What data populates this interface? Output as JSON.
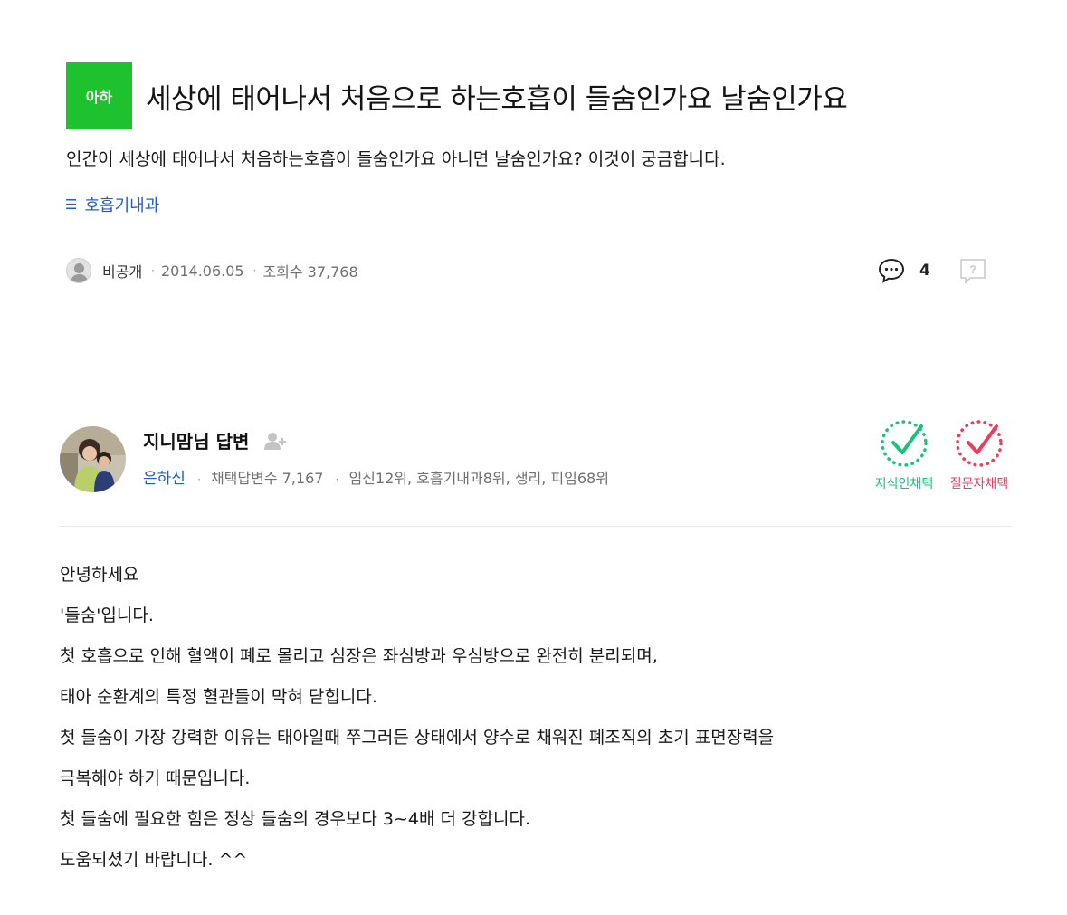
{
  "question": {
    "badge_label": "아하",
    "title": "세상에 태어나서 처음으로 하는호흡이 들숨인가요 날숨인가요",
    "body": "인간이 세상에 태어나서 처음하는호흡이 들숨인가요 아니면 날숨인가요? 이것이 궁금합니다.",
    "category": "호흡기내과",
    "author": "비공개",
    "date": "2014.06.05",
    "views": "조회수 37,768",
    "comment_count": "4"
  },
  "answer": {
    "answerer_name": "지니맘님 답변",
    "level": "은하신",
    "stats": "채택답변수 7,167",
    "rankings": "임신12위, 호흡기내과8위, 생리, 피임68위",
    "badges": {
      "expert_label": "지식인채택",
      "asker_label": "질문자채택"
    },
    "lines": [
      "안녕하세요",
      "'들숨'입니다.",
      "첫 호흡으로 인해 혈액이 폐로 몰리고 심장은 좌심방과 우심방으로 완전히 분리되며,",
      "태아 순환계의 특정 혈관들이 막혀 닫힙니다.",
      "첫 들숨이 가장 강력한 이유는 태아일때 쭈그러든 상태에서 양수로 채워진 폐조직의 초기 표면장력을",
      "극복해야 하기 때문입니다.",
      "첫 들숨에 필요한 힘은 정상 들숨의 경우보다 3~4배 더 강합니다.",
      "도움되셨기 바랍니다. ^^"
    ]
  },
  "icons": {
    "category": "list-icon",
    "comment": "speech-bubble-icon",
    "report": "question-report-icon",
    "add_friend": "person-add-icon",
    "expert_badge": "check-circle-icon",
    "asker_badge": "check-circle-icon"
  },
  "colors": {
    "brand_green": "#1ec12e",
    "link_blue": "#1f5cd8",
    "expert_green": "#17c47a",
    "asker_red": "#ee3d5b"
  }
}
